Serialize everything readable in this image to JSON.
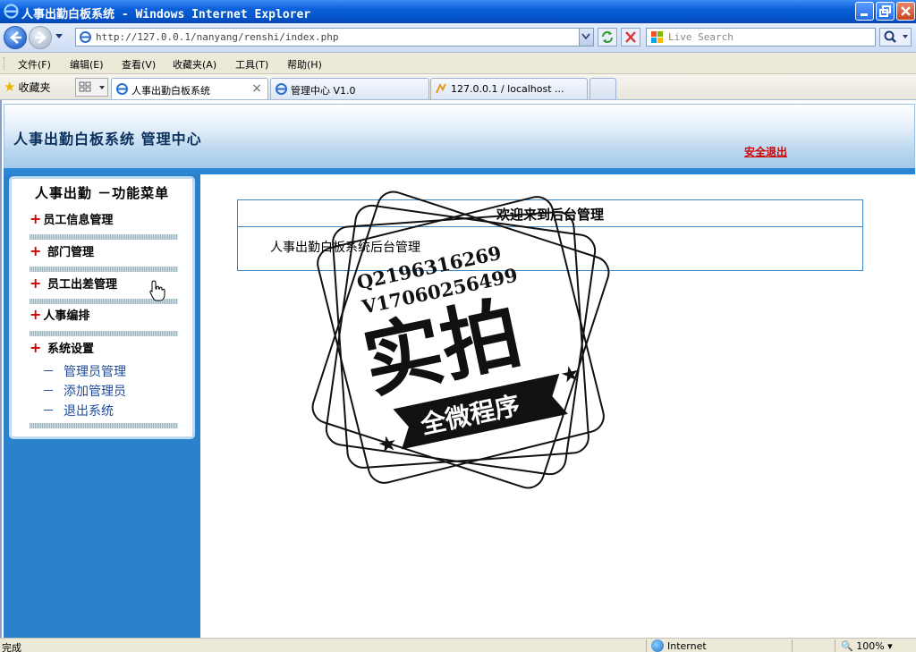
{
  "window": {
    "title": "人事出勤白板系统 - Windows Internet Explorer"
  },
  "addressbar": {
    "url": "http://127.0.0.1/nanyang/renshi/index.php",
    "search_placeholder": "Live Search"
  },
  "menu": {
    "items": [
      "文件(F)",
      "编辑(E)",
      "查看(V)",
      "收藏夹(A)",
      "工具(T)",
      "帮助(H)"
    ]
  },
  "tabs": {
    "favorites_label": "收藏夹",
    "items": [
      {
        "label": "人事出勤白板系统",
        "active": true
      },
      {
        "label": "管理中心 V1.0",
        "active": false
      },
      {
        "label": "127.0.0.1 / localhost ...",
        "active": false
      }
    ]
  },
  "site": {
    "header_title": "人事出勤白板系统 管理中心",
    "logout_label": "安全退出",
    "menu_title": "人事出勤 －功能菜单",
    "sections": [
      "员工信息管理",
      "部门管理",
      "员工出差管理",
      "人事编排",
      "系统设置"
    ],
    "subitems": [
      "管理员管理",
      "添加管理员",
      "退出系统"
    ],
    "welcome_title": "欢迎来到后台管理",
    "welcome_body": "人事出勤白板系统后台管理"
  },
  "watermark": {
    "line1": "Q2196316269",
    "line2": "V17060256499",
    "main": "实拍",
    "banner": "全微程序"
  },
  "status": {
    "text": "完成",
    "zone": "Internet",
    "zoom": "100%"
  },
  "colors": {
    "accent_blue": "#2a82cc",
    "logout_red": "#d40000"
  }
}
